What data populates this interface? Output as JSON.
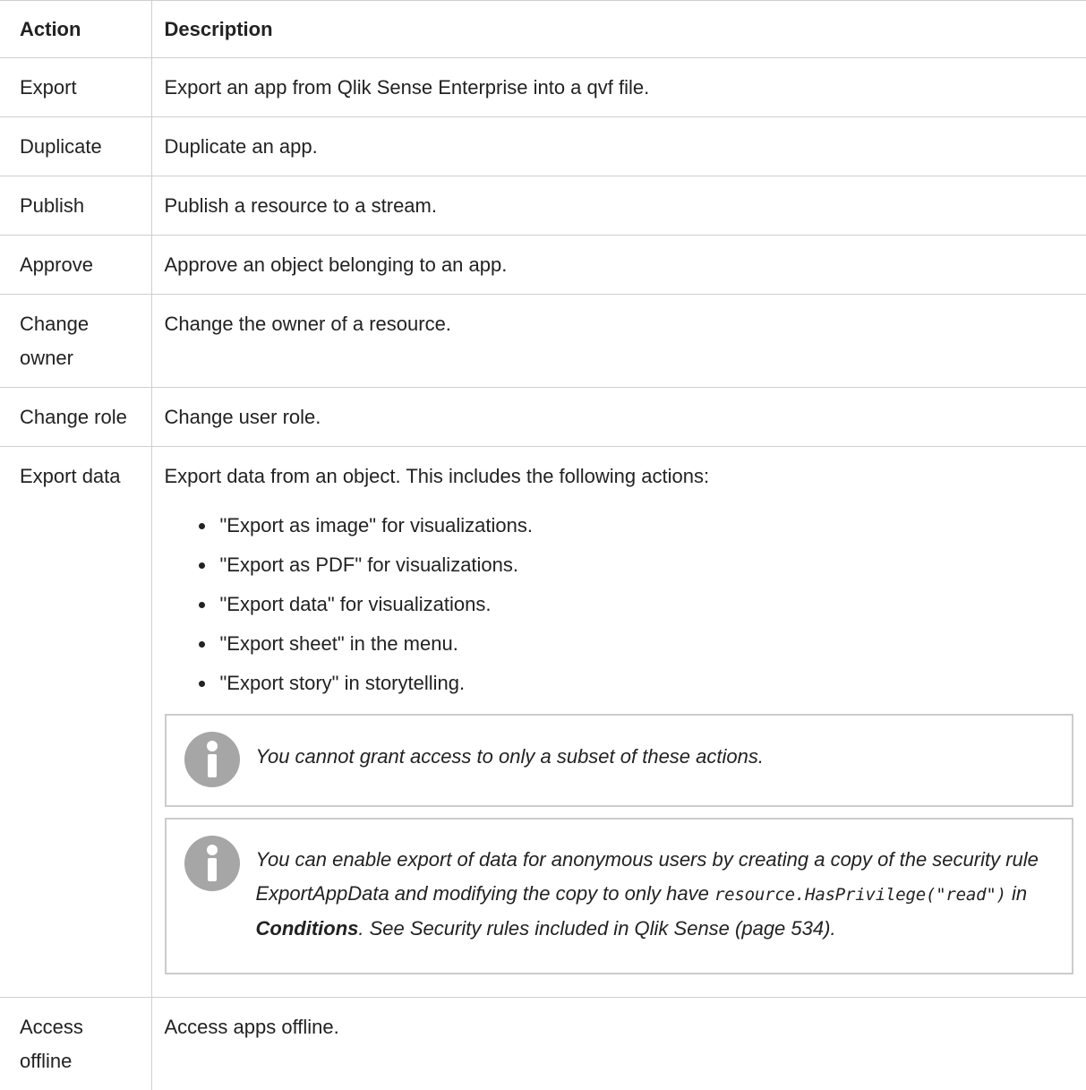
{
  "table": {
    "headers": {
      "action": "Action",
      "description": "Description"
    },
    "rows": [
      {
        "action": "Export",
        "description": "Export an app from Qlik Sense Enterprise into a qvf file."
      },
      {
        "action": "Duplicate",
        "description": "Duplicate an app."
      },
      {
        "action": "Publish",
        "description": "Publish a resource to a stream."
      },
      {
        "action": "Approve",
        "description": "Approve an object belonging to an app."
      },
      {
        "action_line1": "Change",
        "action_line2": "owner",
        "description": "Change the owner of a resource."
      },
      {
        "action": "Change role",
        "description": "Change user role."
      },
      {
        "action": "Export data",
        "description": "Export data from an object. This includes the following actions:",
        "bullets": [
          "\"Export as image\" for visualizations.",
          "\"Export as PDF\" for visualizations.",
          "\"Export data\" for visualizations.",
          "\"Export sheet\" in the menu.",
          "\"Export story\" in storytelling."
        ],
        "note1": {
          "icon": "info-icon",
          "text": "You cannot grant access to only a subset of these actions."
        },
        "note2": {
          "icon": "info-icon",
          "text_a": "You can enable export of data for anonymous users by creating a copy of the security rule ExportAppData and modifying the copy to only have ",
          "code": "resource.HasPrivilege(\"read\")",
          "text_b": " in ",
          "bold": "Conditions",
          "text_c": ". See Security rules included in Qlik Sense (page 534)."
        }
      },
      {
        "action_line1": "Access",
        "action_line2": "offline",
        "description": "Access apps offline."
      }
    ]
  },
  "colors": {
    "border": "#cfcfcf",
    "note_border": "#cccccc",
    "icon_gray": "#a6a6a6",
    "text": "#222222"
  }
}
